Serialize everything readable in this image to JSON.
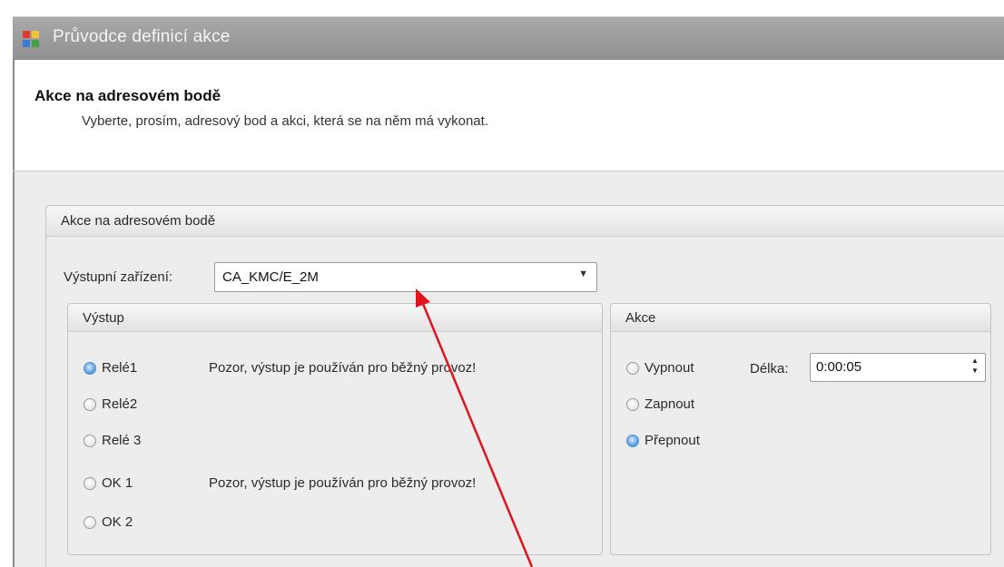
{
  "window": {
    "title": "Průvodce definicí akce"
  },
  "header": {
    "title": "Akce na adresovém bodě",
    "subtitle": "Vyberte, prosím, adresový bod a akci, která se  na něm má vykonat."
  },
  "group": {
    "title": "Akce na adresovém bodě",
    "device_label": "Výstupní zařízení:",
    "device_value": "CA_KMC/E_2M"
  },
  "output_panel": {
    "title": "Výstup",
    "options": [
      {
        "label": "Relé1",
        "checked": true,
        "warning": "Pozor, výstup je používán pro běžný provoz!"
      },
      {
        "label": "Relé2",
        "checked": false,
        "warning": ""
      },
      {
        "label": "Relé 3",
        "checked": false,
        "warning": ""
      },
      {
        "label": "OK 1",
        "checked": false,
        "warning": "Pozor, výstup je používán pro běžný provoz!"
      },
      {
        "label": "OK 2",
        "checked": false,
        "warning": ""
      }
    ]
  },
  "action_panel": {
    "title": "Akce",
    "options": [
      {
        "label": "Vypnout",
        "checked": false
      },
      {
        "label": "Zapnout",
        "checked": false
      },
      {
        "label": "Přepnout",
        "checked": true
      }
    ],
    "length_label": "Délka:",
    "length_value": "0:00:05"
  },
  "colors": {
    "annotation_arrow": "#e0141e",
    "radio_checked": "#4f8fd6"
  }
}
